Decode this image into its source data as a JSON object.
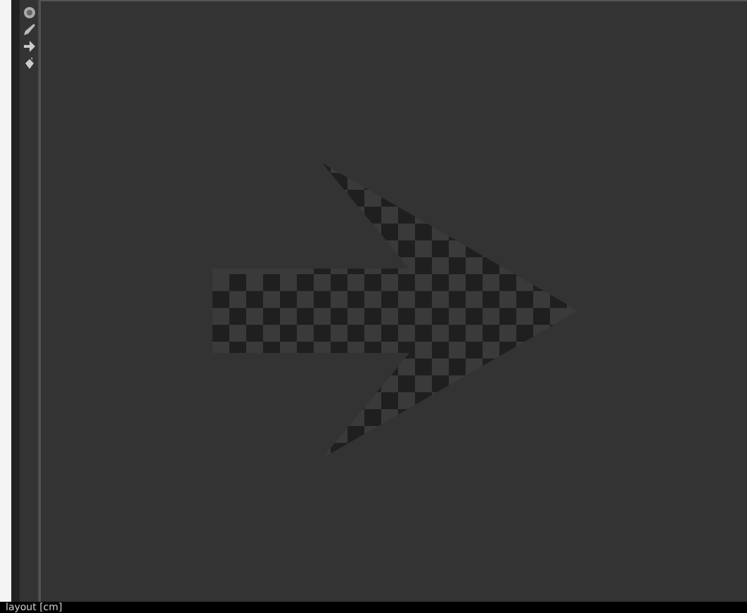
{
  "toolbar": {
    "tools": [
      {
        "kind": "target"
      },
      {
        "kind": "pen"
      },
      {
        "kind": "arrow"
      },
      {
        "kind": "bucket"
      }
    ]
  },
  "status_bar": {
    "text": "layout [cm]"
  }
}
